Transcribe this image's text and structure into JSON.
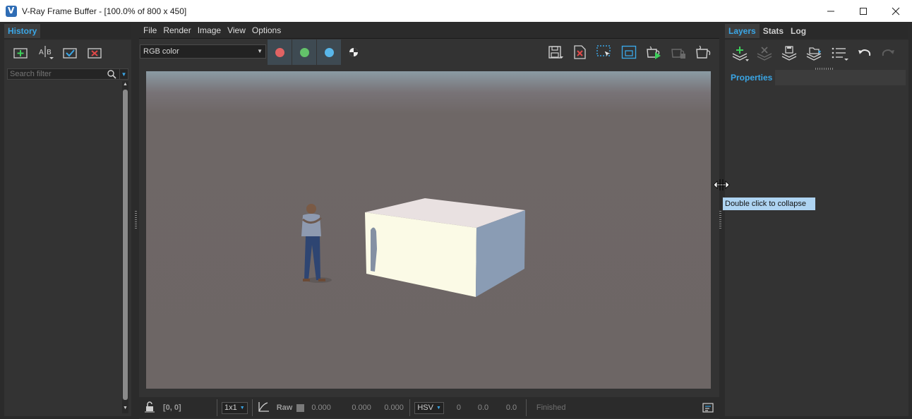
{
  "window": {
    "title": "V-Ray Frame Buffer - [100.0% of 800 x 450]",
    "buttons": [
      "minimize",
      "maximize",
      "close"
    ]
  },
  "history": {
    "tab": "History",
    "search_placeholder": "Search filter",
    "tools": [
      "add-to-history-icon",
      "ab-compare-icon",
      "check-icon",
      "remove-icon"
    ]
  },
  "menu": [
    "File",
    "Render",
    "Image",
    "View",
    "Options"
  ],
  "toolbar": {
    "channel": "RGB color",
    "channel_buttons": [
      {
        "name": "red-channel",
        "color": "#e06363"
      },
      {
        "name": "green-channel",
        "color": "#63c26a"
      },
      {
        "name": "blue-channel",
        "color": "#59b7ea"
      }
    ],
    "accent": "#3aa6e6"
  },
  "status": {
    "coords": "[0, 0]",
    "sample": "1x1",
    "raw_label": "Raw",
    "rgb": [
      "0.000",
      "0.000",
      "0.000"
    ],
    "color_mode": "HSV",
    "hsv": [
      "0",
      "0.0",
      "0.0"
    ],
    "state": "Finished"
  },
  "right_panel": {
    "tabs": [
      "Layers",
      "Stats",
      "Log"
    ],
    "active_tab": "Layers",
    "properties_label": "Properties"
  },
  "tooltip": "Double click to collapse"
}
